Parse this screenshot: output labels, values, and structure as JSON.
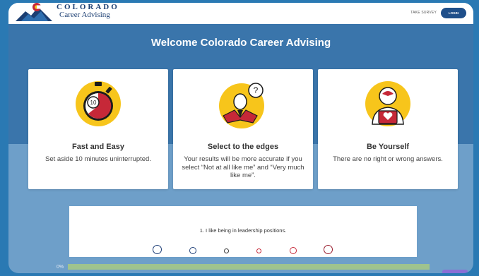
{
  "header": {
    "logo_title": "COLORADO",
    "logo_subtitle": "Career Advising",
    "nav_take_survey": "TAKE SURVEY",
    "login_label": "LOGIN"
  },
  "hero": {
    "title": "Welcome Colorado Career Advising"
  },
  "cards": [
    {
      "title": "Fast and Easy",
      "description": "Set aside 10 minutes uninterrupted.",
      "icon": "stopwatch-icon",
      "timer_text": "10"
    },
    {
      "title": "Select to the edges",
      "description": "Your results will be more accurate if you select “Not at all like me” and “Very much like me”.",
      "icon": "question-person-icon",
      "bubble_text": "?"
    },
    {
      "title": "Be Yourself",
      "description": "There are no right or wrong answers.",
      "icon": "heart-person-icon"
    }
  ],
  "survey": {
    "question": "1. I like being in leadership positions.",
    "options_count": 6
  },
  "progress": {
    "label": "0%",
    "value": 0
  },
  "colors": {
    "hero": "#3a75ab",
    "page": "#6e9fc9",
    "accent_yellow": "#f7c51b",
    "accent_red": "#c62838",
    "navy": "#1f4f8a"
  }
}
